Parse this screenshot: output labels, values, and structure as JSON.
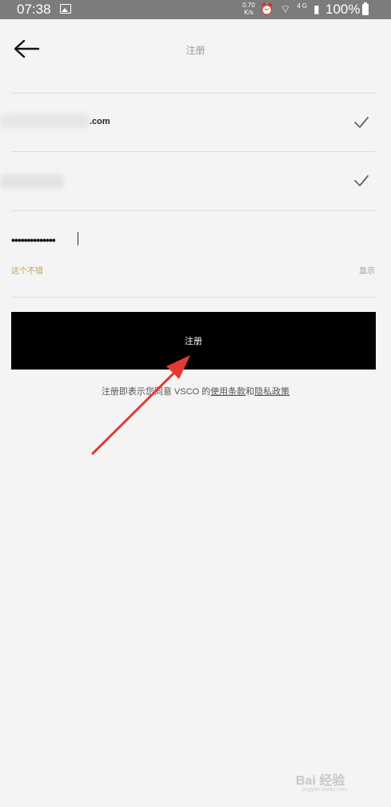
{
  "status_bar": {
    "time": "07:38",
    "speed_value": "0.70",
    "speed_unit": "K/s",
    "network_label": "4G",
    "battery_percent": "100%"
  },
  "header": {
    "title": "注册"
  },
  "form": {
    "email_suffix": ".com",
    "password_mask": "••••••••••••••",
    "password_strength": "这个不错",
    "show_label": "显示"
  },
  "signup_button": {
    "label": "注册"
  },
  "terms": {
    "prefix": "注册即表示您同意 VSCO 的",
    "terms_link": "使用条款",
    "joiner": "和",
    "privacy_link": "隐私政策"
  },
  "annotation": {
    "arrow_color": "#e53935"
  },
  "watermark": {
    "text": "Bai 经验",
    "sub": "jingyan.baidu.com"
  }
}
